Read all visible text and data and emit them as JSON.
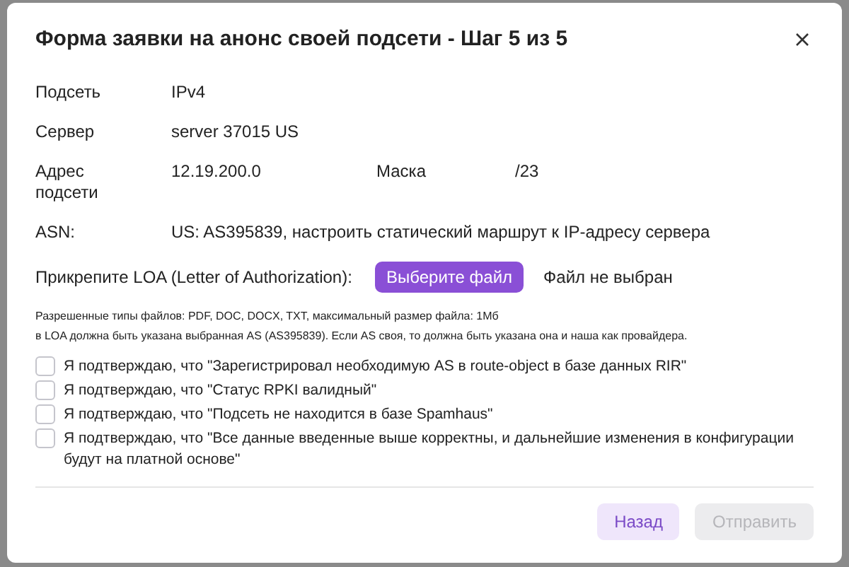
{
  "dialog": {
    "title": "Форма заявки на анонс своей подсети - Шаг 5 из 5"
  },
  "fields": [
    {
      "label": "Подсеть",
      "value": "IPv4"
    },
    {
      "label": "Сервер",
      "value": "server 37015 US"
    },
    {
      "label": "Адрес подсети",
      "value": "12.19.200.0",
      "extra_label": "Маска",
      "extra_value": "/23"
    },
    {
      "label": "ASN:",
      "value": "US: AS395839, настроить статический маршрут к IP-адресу сервера"
    }
  ],
  "attachment": {
    "label": "Прикрепите LOA (Letter of Authorization):",
    "button": "Выберите файл",
    "status": "Файл не выбран"
  },
  "notes": [
    "Разрешенные типы файлов: PDF, DOC, DOCX, TXT, максимальный размер файла: 1Мб",
    "в LOA должна быть указана выбранная AS (AS395839). Если AS своя, то должна быть указана она и наша как провайдера."
  ],
  "confirmations": [
    {
      "label": "Я подтверждаю, что \"Зарегистрировал необходимую AS в route-object в базе данных RIR\"",
      "checked": false
    },
    {
      "label": "Я подтверждаю, что \"Статус RPKI валидный\"",
      "checked": false
    },
    {
      "label": "Я подтверждаю, что \"Подсеть не находится в базе Spamhaus\"",
      "checked": false
    },
    {
      "label": "Я подтверждаю, что \"Все данные введенные выше корректны, и дальнейшие изменения в конфигурации будут на платной основе\"",
      "checked": false
    }
  ],
  "buttons": [
    {
      "label": "Назад",
      "kind": "secondary",
      "disabled": false
    },
    {
      "label": "Отправить",
      "kind": "primary",
      "disabled": true
    }
  ]
}
